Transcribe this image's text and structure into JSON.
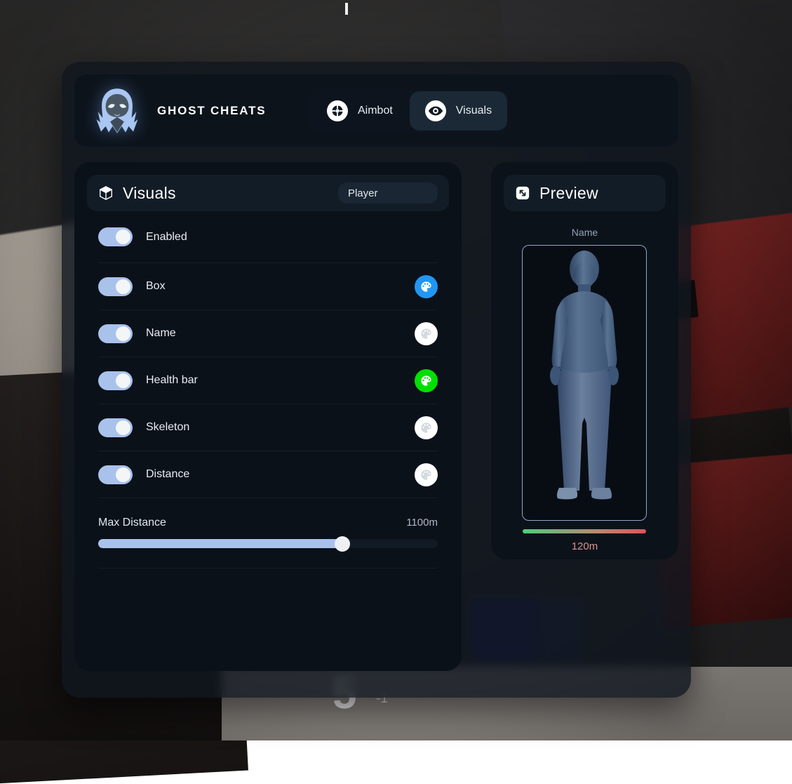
{
  "app": {
    "brand_title": "GHOST CHEATS",
    "logo_icon": "ghost-reaper-icon"
  },
  "tabs": [
    {
      "label": "Aimbot",
      "icon": "crosshair-icon",
      "active": false
    },
    {
      "label": "Visuals",
      "icon": "eye-icon",
      "active": true
    }
  ],
  "visuals_panel": {
    "icon": "box-package-icon",
    "title": "Visuals",
    "chip_label": "Player",
    "rows": [
      {
        "label": "Enabled",
        "toggle": true,
        "swatch": null
      },
      {
        "label": "Box",
        "toggle": true,
        "swatch": "#2196f3",
        "swatch_icon": "palette-icon"
      },
      {
        "label": "Name",
        "toggle": true,
        "swatch": "#ffffff",
        "swatch_icon": "palette-icon"
      },
      {
        "label": "Health bar",
        "toggle": true,
        "swatch": "#00e000",
        "swatch_icon": "palette-icon"
      },
      {
        "label": "Skeleton",
        "toggle": true,
        "swatch": "#ffffff",
        "swatch_icon": "palette-icon"
      },
      {
        "label": "Distance",
        "toggle": true,
        "swatch": "#ffffff",
        "swatch_icon": "palette-icon"
      }
    ],
    "slider": {
      "label": "Max Distance",
      "value_text": "1100m",
      "percent": 72
    }
  },
  "preview_panel": {
    "icon": "shrink-arrows-icon",
    "title": "Preview",
    "name_label": "Name",
    "distance_label": "120m",
    "healthbar_colors": [
      "#4fd07a",
      "#e2515a"
    ]
  },
  "game_hud": {
    "ammo": "5",
    "ammo_reserve": "-1"
  },
  "colors": {
    "accent_toggle": "#a9c2ec",
    "panel_bg": "#0b1119",
    "header_bg": "#0c131b",
    "tab_active_bg": "#1b2836"
  }
}
